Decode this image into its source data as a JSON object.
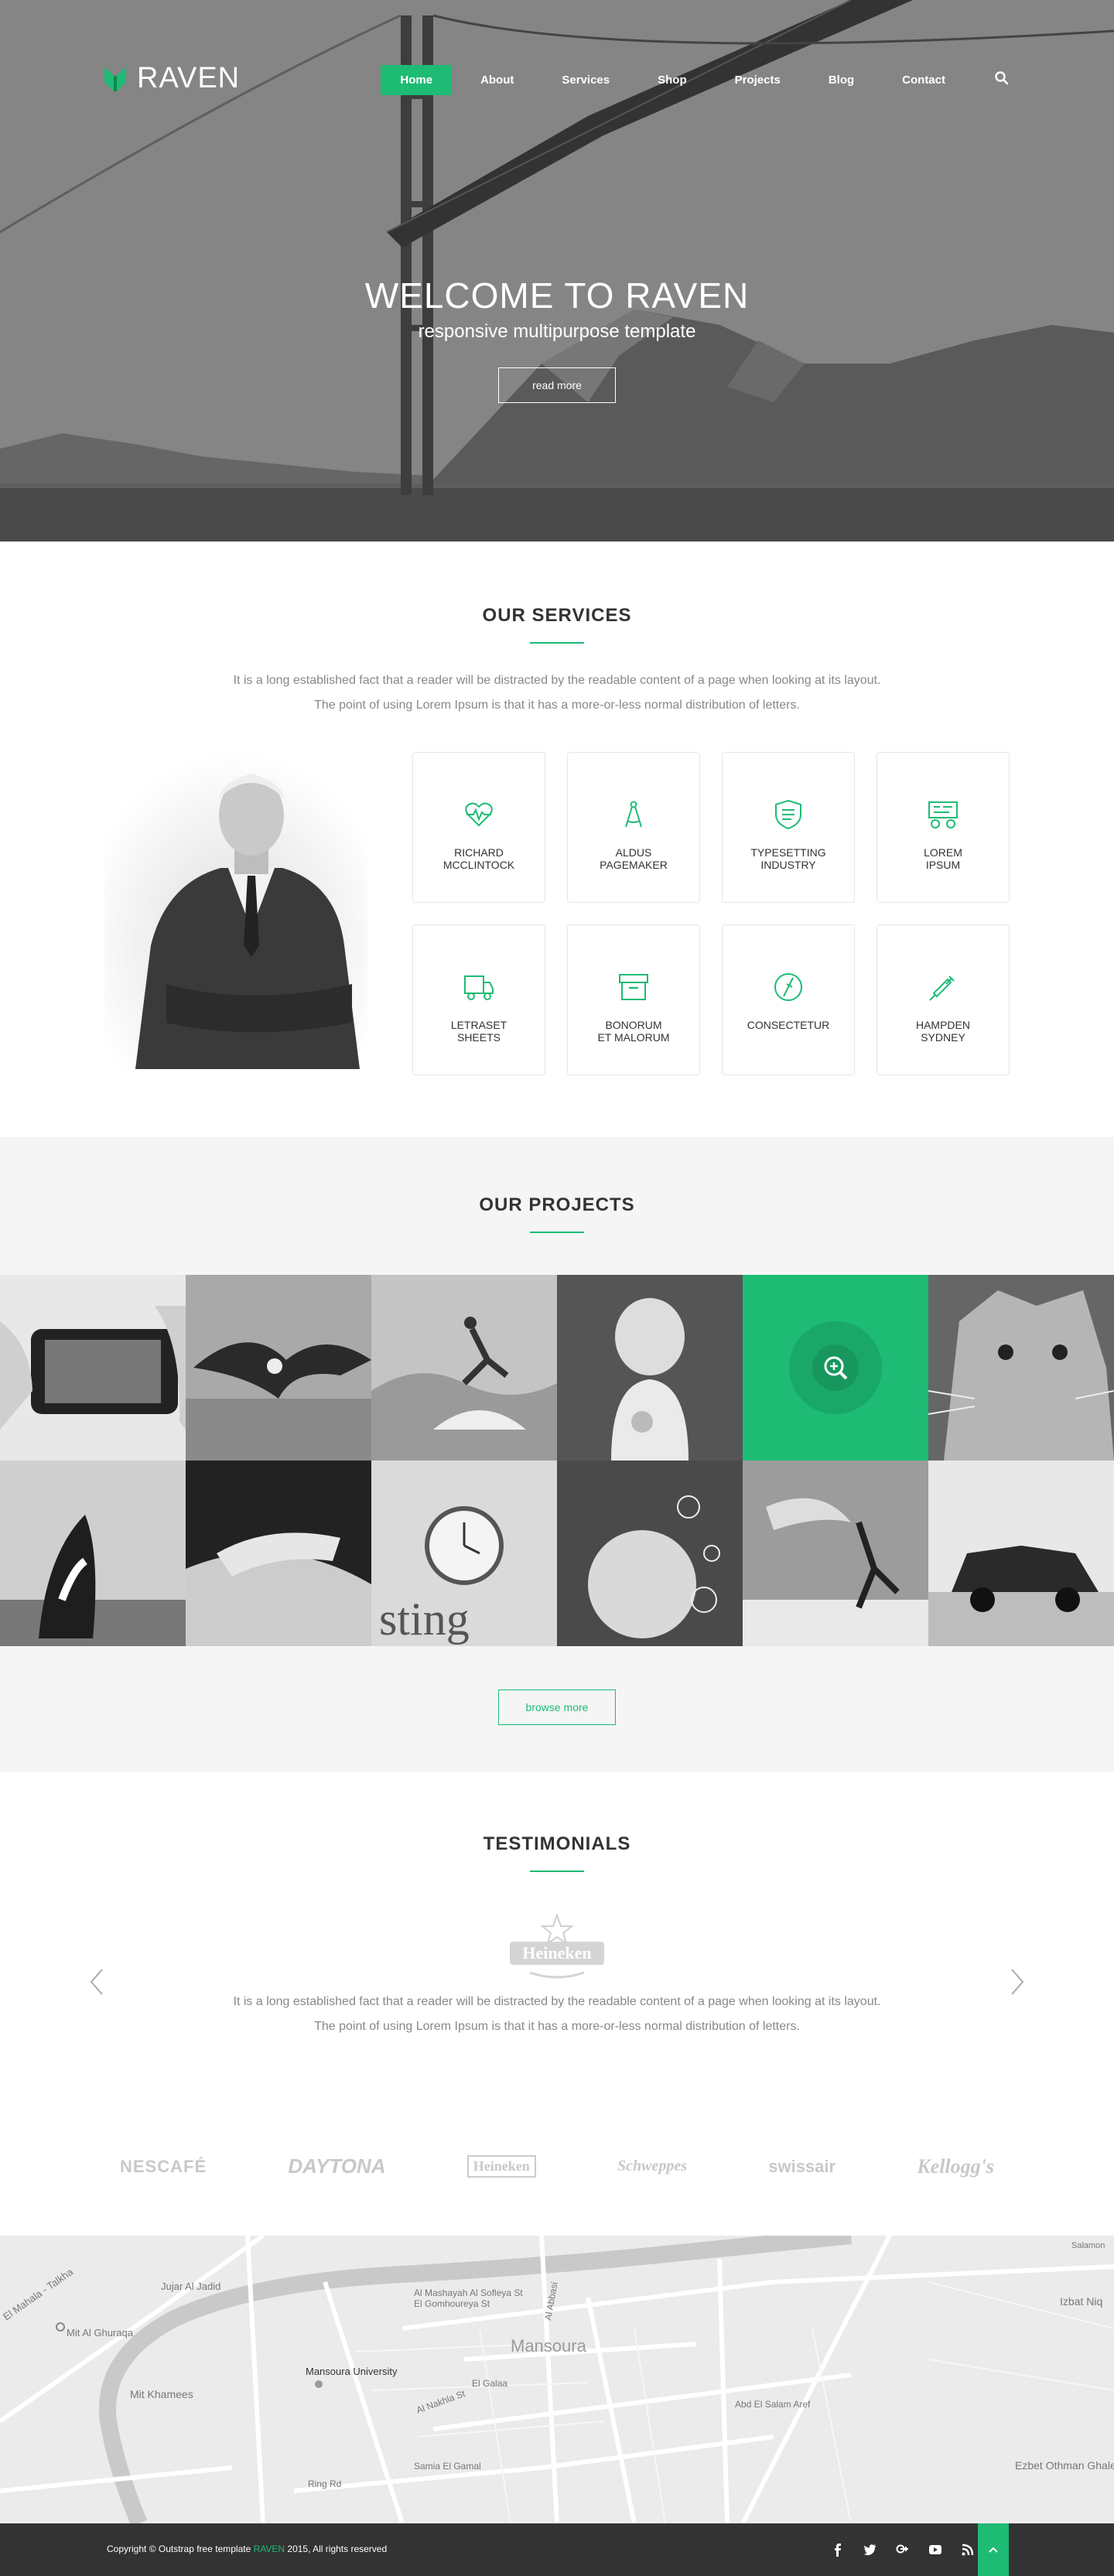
{
  "brand": {
    "name": "RAVEN",
    "accent": "#1dbb74"
  },
  "nav": {
    "items": [
      {
        "label": "Home",
        "active": true
      },
      {
        "label": "About"
      },
      {
        "label": "Services"
      },
      {
        "label": "Shop"
      },
      {
        "label": "Projects"
      },
      {
        "label": "Blog"
      },
      {
        "label": "Contact"
      }
    ],
    "search_icon": "search-icon"
  },
  "hero": {
    "title": "WELCOME TO RAVEN",
    "subtitle": "responsive multipurpose template",
    "button": "read more"
  },
  "services": {
    "title": "OUR SERVICES",
    "desc_1": "It is a long established fact that a reader will be distracted by the readable content of a page when looking at its layout.",
    "desc_2": "The point of using Lorem Ipsum is that it has a more-or-less normal distribution of letters.",
    "cards": [
      {
        "label": "RICHARD\nMCCLINTOCK",
        "icon": "heartbeat-icon"
      },
      {
        "label": "ALDUS\nPAGEMAKER",
        "icon": "compass-icon"
      },
      {
        "label": "TYPESETTING\nINDUSTRY",
        "icon": "shield-document-icon"
      },
      {
        "label": "LOREM\nIPSUM",
        "icon": "cart-icon"
      },
      {
        "label": "LETRASET\nSHEETS",
        "icon": "truck-icon"
      },
      {
        "label": "BONORUM\nET MALORUM",
        "icon": "archive-icon"
      },
      {
        "label": "CONSECTETUR",
        "icon": "pencil-circle-icon"
      },
      {
        "label": "HAMPDEN\nSYDNEY",
        "icon": "syringe-icon"
      }
    ]
  },
  "projects": {
    "title": "OUR PROJECTS",
    "button": "browse more",
    "tiles": [
      "phone-photo",
      "eagle",
      "surfer",
      "girl-flowers",
      "camera-hover",
      "cat",
      "orca",
      "hands",
      "pocket-watch",
      "dog-bubbles",
      "dancer",
      "vintage-car"
    ]
  },
  "testimonials": {
    "title": "TESTIMONIALS",
    "logo": "Heineken",
    "quote_1": "It is a long established fact that a reader will be distracted by the readable content of a page when looking at its layout.",
    "quote_2": "The point of using Lorem Ipsum is that it has a more-or-less normal distribution of letters."
  },
  "brands": [
    "NESCAFÉ",
    "DAYTONA",
    "Heineken",
    "Schweppes",
    "swissair",
    "Kellogg's"
  ],
  "map": {
    "labels": [
      {
        "text": "El Mahala - Talkha"
      },
      {
        "text": "Jujar Al Jadid"
      },
      {
        "text": "Mit Al Ghuraqa"
      },
      {
        "text": "Mit Khamees"
      },
      {
        "text": "Mansoura University"
      },
      {
        "text": "Mansoura"
      },
      {
        "text": "El Gomhoureya St"
      },
      {
        "text": "Al Mashayah Al Sofleya St"
      },
      {
        "text": "Al Abbasi"
      },
      {
        "text": "El Galaa"
      },
      {
        "text": "Al Nakhla St"
      },
      {
        "text": "Samia El Gamal"
      },
      {
        "text": "Ring Rd"
      },
      {
        "text": "Abd El Salam Aref"
      },
      {
        "text": "Izbat Niq"
      },
      {
        "text": "Ezbet Othman Ghaleb"
      },
      {
        "text": "Salamon"
      }
    ]
  },
  "footer": {
    "copy_prefix": "Copyright © Outstrap free template",
    "copy_brand": "RAVEN",
    "copy_suffix": "2015, All rights reserved",
    "social": [
      "facebook-icon",
      "twitter-icon",
      "google-plus-icon",
      "youtube-icon",
      "rss-icon"
    ]
  }
}
